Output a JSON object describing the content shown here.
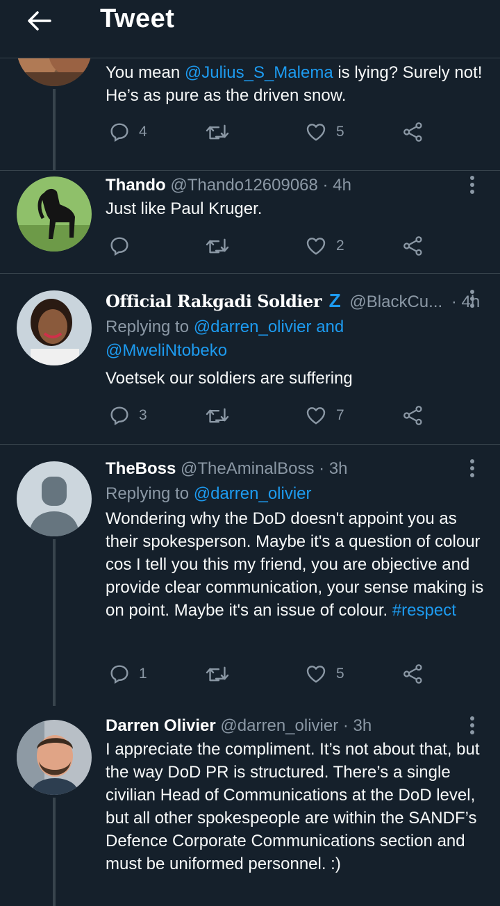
{
  "header": {
    "title": "Tweet",
    "back_icon": "arrow-left-icon"
  },
  "colors": {
    "background": "#15202b",
    "link": "#1d9bf0",
    "muted": "#8b98a5",
    "border": "#38444d"
  },
  "tweets": [
    {
      "body_before": "You mean ",
      "mention": "@Julius_S_Malema",
      "body_after": " is lying? Surely not! He’s as pure as the driven snow.",
      "replies": "4",
      "retweets": "",
      "likes": "5"
    },
    {
      "name": "Thando",
      "handle": "@Thando12609068",
      "sep": "·",
      "time": "4h",
      "body": "Just like Paul Kruger.",
      "replies": "",
      "retweets": "",
      "likes": "2"
    },
    {
      "name": "Official Rakgadi Soldier",
      "badge": "Z",
      "handle": "@BlackCu...",
      "sep": "·",
      "time": "4h",
      "replying_label": "Replying to ",
      "reply_user1": "@darren_olivier",
      "reply_and": " and",
      "reply_user2": "@MweliNtobeko",
      "body": "Voetsek our soldiers are suffering",
      "replies": "3",
      "retweets": "",
      "likes": "7"
    },
    {
      "name": "TheBoss",
      "handle": "@TheAminalBoss",
      "sep": "·",
      "time": "3h",
      "replying_label": "Replying to ",
      "reply_user1": "@darren_olivier",
      "body": "Wondering why the DoD doesn't appoint you as their spokesperson. Maybe it's a question of colour cos I tell you this my friend, you are objective and provide clear communication, your sense making is on point. Maybe it's an issue of colour. ",
      "hashtag": "#respect",
      "replies": "1",
      "retweets": "",
      "likes": "5"
    },
    {
      "name": "Darren Olivier",
      "handle": "@darren_olivier",
      "sep": "·",
      "time": "3h",
      "body": "I appreciate the compliment. It’s not about that, but the way DoD PR is structured. There’s a single civilian Head of Communications at the DoD level, but all other spokespeople are within the SANDF’s Defence Corporate Communications section and must be uniformed personnel. :)"
    }
  ]
}
